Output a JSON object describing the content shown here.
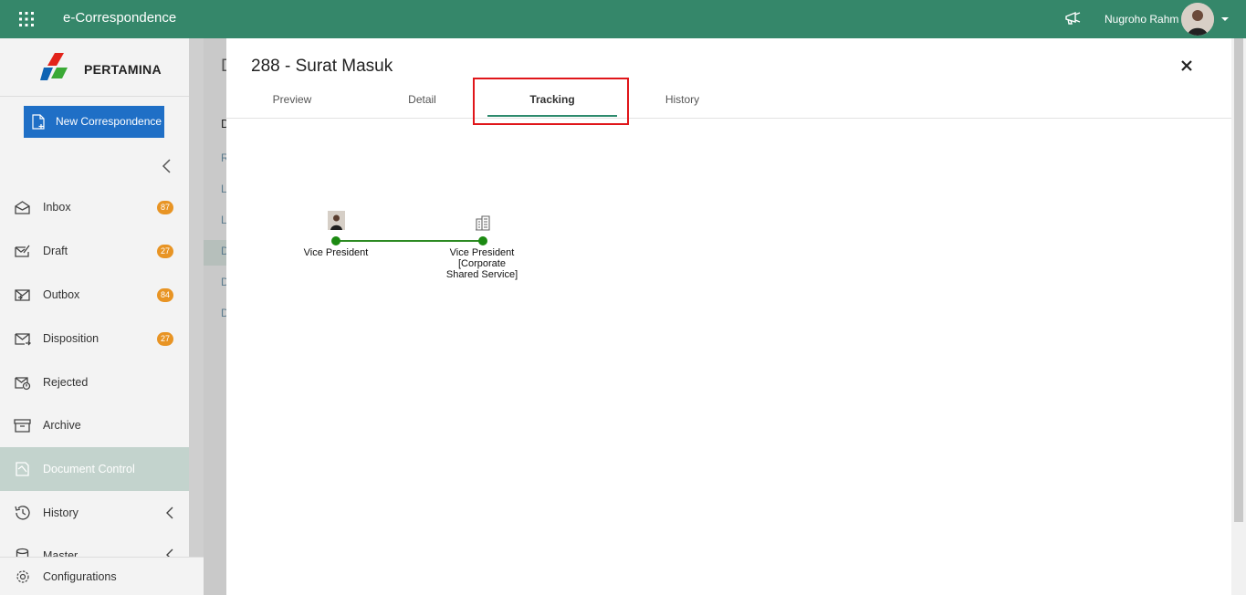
{
  "topbar": {
    "app_title": "e-Correspondence",
    "user_name": "Nugroho Rahm",
    "color": "#35876a"
  },
  "sidebar": {
    "logo_text": "PERTAMINA",
    "new_button_label": "New Correspondence",
    "items": [
      {
        "label": "Inbox",
        "badge": "87",
        "icon": "inbox-icon"
      },
      {
        "label": "Draft",
        "badge": "27",
        "icon": "draft-icon"
      },
      {
        "label": "Outbox",
        "badge": "84",
        "icon": "outbox-icon"
      },
      {
        "label": "Disposition",
        "badge": "27",
        "icon": "disposition-icon"
      },
      {
        "label": "Rejected",
        "badge": "",
        "icon": "rejected-icon"
      },
      {
        "label": "Archive",
        "badge": "",
        "icon": "archive-icon"
      },
      {
        "label": "Document Control",
        "badge": "",
        "icon": "document-control-icon"
      },
      {
        "label": "History",
        "badge": "",
        "icon": "history-icon"
      },
      {
        "label": "Master",
        "badge": "",
        "icon": "master-icon"
      }
    ],
    "configurations_label": "Configurations"
  },
  "backdrop": {
    "heading_initial": "D",
    "sub_heading_initial": "D",
    "stub_items": [
      "R",
      "L",
      "L",
      "D",
      "D",
      "D"
    ]
  },
  "modal": {
    "title": "288 - Surat Masuk",
    "tabs": [
      "Preview",
      "Detail",
      "Tracking",
      "History"
    ],
    "active_tab": "Tracking"
  },
  "tracking": {
    "nodes": [
      {
        "label": "Vice President",
        "icon": "person-photo-icon"
      },
      {
        "label_lines": [
          "Vice President",
          "[Corporate",
          "Shared Service]"
        ],
        "icon": "building-icon"
      }
    ],
    "line_color": "#2c8a22"
  }
}
